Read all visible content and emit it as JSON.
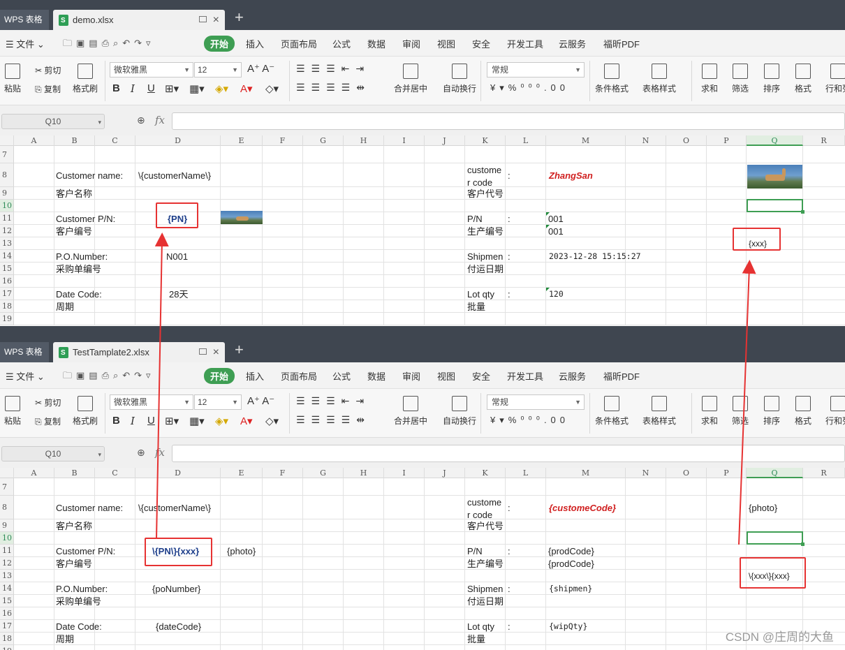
{
  "app_name": "WPS 表格",
  "windows": [
    {
      "file_name": "demo.xlsx"
    },
    {
      "file_name": "TestTamplate2.xlsx"
    }
  ],
  "menu": {
    "file": "文件",
    "tabs": [
      "开始",
      "插入",
      "页面布局",
      "公式",
      "数据",
      "审阅",
      "视图",
      "安全",
      "开发工具",
      "云服务",
      "福昕PDF"
    ]
  },
  "ribbon": {
    "paste": "粘贴",
    "cut": "剪切",
    "copy": "复制",
    "format_painter": "格式刷",
    "font_name": "微软雅黑",
    "font_size": "12",
    "merge_center": "合并居中",
    "wrap_text": "自动换行",
    "number_format": "常规",
    "conditional_format": "条件格式",
    "table_style": "表格样式",
    "sum": "求和",
    "filter": "筛选",
    "sort": "排序",
    "format": "格式",
    "rows_cols": "行和列"
  },
  "formula_bar": {
    "name_box": "Q10",
    "fx": "fx",
    "formula": ""
  },
  "columns": [
    "A",
    "B",
    "C",
    "D",
    "E",
    "F",
    "G",
    "H",
    "I",
    "J",
    "K",
    "L",
    "M",
    "N",
    "O",
    "P",
    "Q",
    "R"
  ],
  "rows": [
    "7",
    "8",
    "9",
    "10",
    "11",
    "12",
    "13",
    "14",
    "15",
    "16",
    "17",
    "18",
    "19"
  ],
  "sheet1": {
    "b8": "Customer name:",
    "d8": "\\{customerName\\}",
    "b9": "客户名称",
    "b11": "Customer P/N:",
    "d11": "{PN}",
    "b12": "客户编号",
    "b14": "P.O.Number:",
    "d14": "N001",
    "b15": "采购单编号",
    "b17": "Date Code:",
    "d17": "28天",
    "b18": "周期",
    "k8a": "custome",
    "k8b": "r code",
    "l8": ":",
    "m8": "ZhangSan",
    "k9": "客户代号",
    "k11": "P/N",
    "l11": ":",
    "m11": "001",
    "k12": "生产编号",
    "m12": "001",
    "k14": "Shipmen",
    "l14": ":",
    "m14": "2023-12-28 15:15:27",
    "k15": "付运日期",
    "k17": "Lot qty",
    "l17": ":",
    "m17": "120",
    "k18": "批量",
    "q13": "{xxx}"
  },
  "sheet2": {
    "b8": "Customer name:",
    "d8": "\\{customerName\\}",
    "b9": "客户名称",
    "b11": "Customer P/N:",
    "d11": "\\{PN\\}{xxx}",
    "e11": "{photo}",
    "b12": "客户编号",
    "b14": "P.O.Number:",
    "d14": "{poNumber}",
    "b15": "采购单编号",
    "b17": "Date Code:",
    "d17": "{dateCode}",
    "b18": "周期",
    "k8a": "custome",
    "k8b": "r code",
    "l8": ":",
    "m8": "{customeCode}",
    "k9": "客户代号",
    "k11": "P/N",
    "l11": ":",
    "m11": "{prodCode}",
    "k12": "生产编号",
    "m12": "{prodCode}",
    "k14": "Shipmen",
    "l14": ":",
    "m14": "{shipmen}",
    "k15": "付运日期",
    "k17": "Lot qty",
    "l17": ":",
    "m17": "{wipQty}",
    "k18": "批量",
    "q8": "{photo}",
    "q13": "\\{xxx\\}{xxx}"
  },
  "watermark": "CSDN @庄周的大鱼",
  "colors": {
    "accent": "#3e9e53",
    "annotation": "#e63232",
    "tabbar": "#3f4650"
  }
}
